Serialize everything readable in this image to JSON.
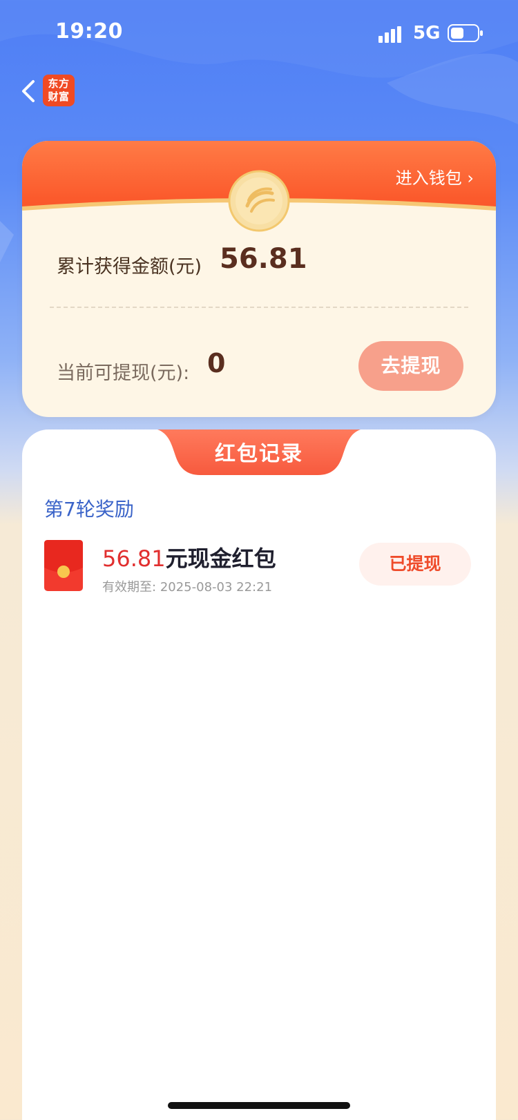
{
  "status_bar": {
    "time": "19:20",
    "network": "5G",
    "icons": [
      "signal-icon",
      "battery-icon"
    ]
  },
  "nav": {
    "back_icon": "chevron-left-icon",
    "logo_text_line1": "东方",
    "logo_text_line2": "财富"
  },
  "wallet": {
    "link": "进入钱包",
    "total_label": "累计获得金额(元)",
    "total_value": "56.81",
    "withdrawable_label": "当前可提现(元):",
    "withdrawable_value": "0",
    "withdraw_button": "去提现"
  },
  "records": {
    "tab_label": "红包记录",
    "round_title": "第7轮奖励",
    "items": [
      {
        "amount": "56.81",
        "unit": "元现金红包",
        "expiry_label": "有效期至:",
        "expiry_date": "2025-08-03 22:21",
        "status": "已提现"
      }
    ]
  },
  "colors": {
    "brand_orange": "#fb5a2c",
    "accent_red": "#e12f2f",
    "link_blue": "#3a63c8"
  }
}
